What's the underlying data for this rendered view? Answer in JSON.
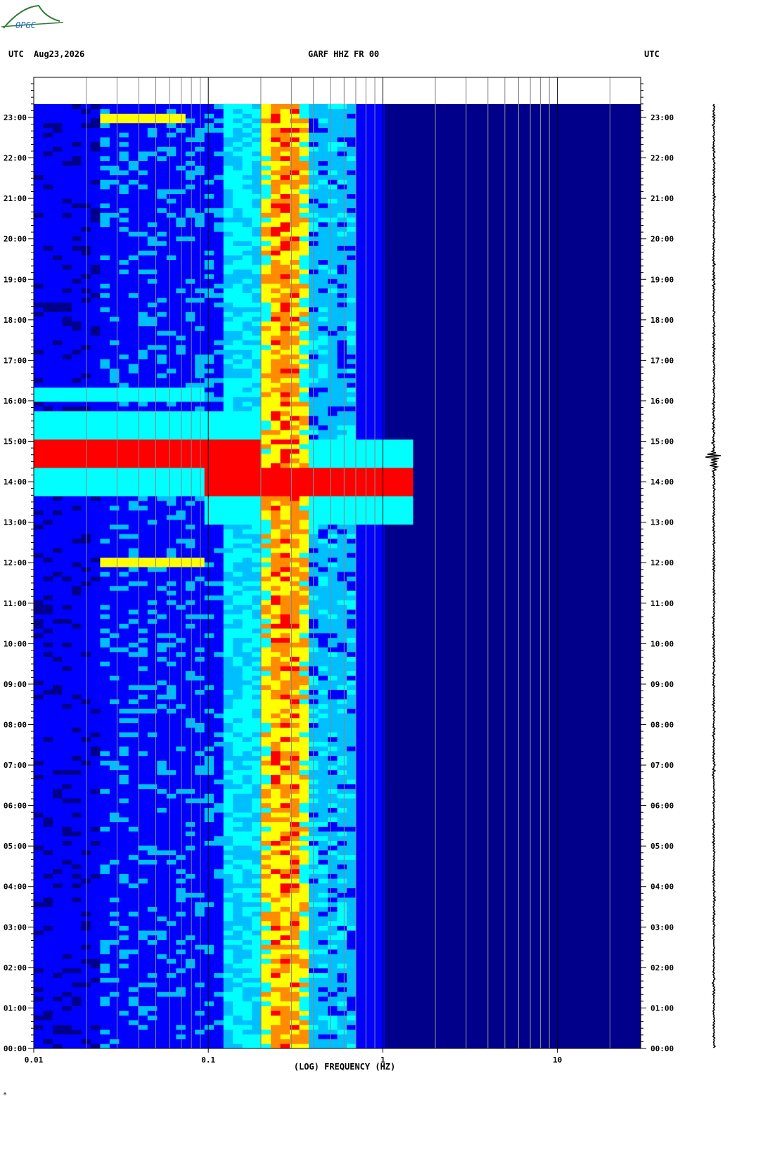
{
  "header": {
    "utc_left": "UTC",
    "date": "Aug23,2026",
    "station": "GARF HHZ FR 00",
    "utc_right": "UTC"
  },
  "logo": {
    "text": "OPGC",
    "color": "#2e7d32",
    "text_color": "#1565c0"
  },
  "footnote": "*",
  "chart_data": {
    "type": "heatmap",
    "title": "GARF HHZ FR 00",
    "xlabel": "(LOG) FREQUENCY (HZ)",
    "x_scale": "log",
    "xlim": [
      0.01,
      30
    ],
    "x_tick_labels": [
      {
        "value": 0.01,
        "label": "0.01"
      },
      {
        "value": 0.1,
        "label": "0.1"
      },
      {
        "value": 1,
        "label": "1"
      },
      {
        "value": 10,
        "label": "10"
      }
    ],
    "y_unit": "UTC hour",
    "ylim": [
      0,
      23.33
    ],
    "y_tick_labels": [
      "00:00",
      "01:00",
      "02:00",
      "03:00",
      "04:00",
      "05:00",
      "06:00",
      "07:00",
      "08:00",
      "09:00",
      "10:00",
      "11:00",
      "12:00",
      "13:00",
      "14:00",
      "15:00",
      "16:00",
      "17:00",
      "18:00",
      "19:00",
      "20:00",
      "21:00",
      "22:00",
      "23:00"
    ],
    "colormap": [
      "#00008b",
      "#0000ff",
      "#00bfff",
      "#00ffff",
      "#ffff00",
      "#ff8c00",
      "#ff0000",
      "#8b0000"
    ],
    "background_band": {
      "freq_range": [
        0.3,
        0.7
      ],
      "hz_peak": [
        0.25,
        0.3
      ],
      "note": "microseism band"
    },
    "events": [
      {
        "time": 14.6,
        "freq_range": [
          0.01,
          0.2
        ],
        "level": "high"
      },
      {
        "time": 13.95,
        "freq_range": [
          0.1,
          1.5
        ],
        "level": "high"
      },
      {
        "time": 11.95,
        "freq_range": [
          0.025,
          0.1
        ],
        "level": "medium"
      },
      {
        "time": 22.95,
        "freq_range": [
          0.025,
          0.07
        ],
        "level": "medium"
      },
      {
        "time": 16.1,
        "freq_range": [
          0.01,
          0.1
        ],
        "level": "low"
      }
    ],
    "trace_event_time": 14.6,
    "grid": true
  }
}
